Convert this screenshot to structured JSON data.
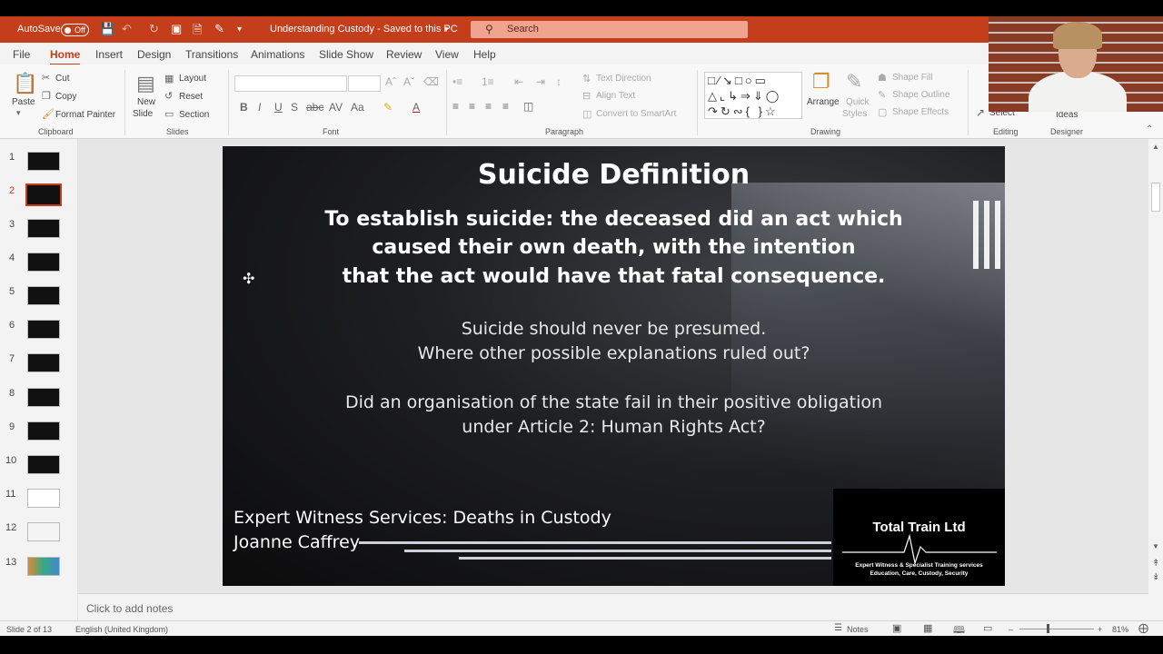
{
  "titlebar": {
    "autosave_label": "AutoSave",
    "autosave_state": "Off",
    "doc_title": "Understanding Custody - Saved to this PC",
    "search_placeholder": "Search"
  },
  "tabs": [
    "File",
    "Home",
    "Insert",
    "Design",
    "Transitions",
    "Animations",
    "Slide Show",
    "Review",
    "View",
    "Help"
  ],
  "ribbon": {
    "clipboard": {
      "paste": "Paste",
      "cut": "Cut",
      "copy": "Copy",
      "format_painter": "Format Painter",
      "group": "Clipboard"
    },
    "slides": {
      "new_slide_1": "New",
      "new_slide_2": "Slide",
      "layout": "Layout",
      "reset": "Reset",
      "section": "Section",
      "group": "Slides"
    },
    "font": {
      "group": "Font"
    },
    "paragraph": {
      "text_direction": "Text Direction",
      "align_text": "Align Text",
      "convert": "Convert to SmartArt",
      "group": "Paragraph"
    },
    "drawing": {
      "arrange": "Arrange",
      "quick_styles_1": "Quick",
      "quick_styles_2": "Styles",
      "shape_fill": "Shape Fill",
      "shape_outline": "Shape Outline",
      "shape_effects": "Shape Effects",
      "group": "Drawing"
    },
    "editing": {
      "select": "Select",
      "group": "Editing"
    },
    "designer": {
      "ideas": "Ideas",
      "group": "Designer"
    }
  },
  "thumbnails": [
    "1",
    "2",
    "3",
    "4",
    "5",
    "6",
    "7",
    "8",
    "9",
    "10",
    "11",
    "12",
    "13"
  ],
  "selected_slide": 2,
  "slide": {
    "title": "Suicide Definition",
    "bold_lines": [
      "To establish suicide: the deceased did an act which",
      "caused their own death, with the intention",
      "that the act would have that fatal consequence."
    ],
    "lines_a": [
      "Suicide should never be presumed.",
      "Where other possible explanations ruled out?"
    ],
    "lines_b": [
      "Did an organisation of the state fail in their positive obligation",
      "under Article 2: Human Rights Act?"
    ],
    "footer_1": "Expert Witness Services: Deaths in Custody",
    "footer_2": "Joanne Caffrey",
    "logo_title": "Total Train Ltd",
    "logo_line1": "Expert Witness & Specialist Training services",
    "logo_line2": "Education, Care, Custody, Security"
  },
  "notes_placeholder": "Click to add notes",
  "status": {
    "slide": "Slide 2 of 13",
    "language": "English (United Kingdom)",
    "notes": "Notes",
    "zoom": "81%"
  },
  "colors": {
    "accent": "#c43e1c"
  }
}
